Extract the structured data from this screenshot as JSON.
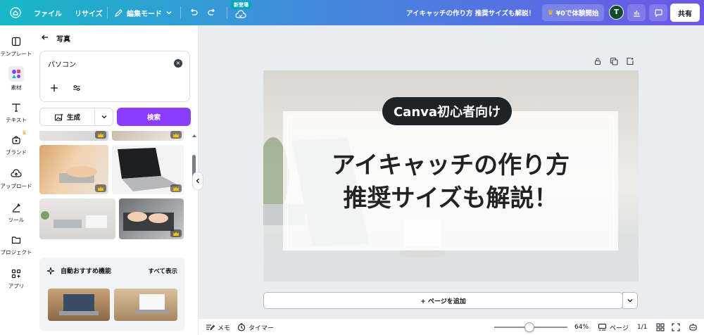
{
  "topbar": {
    "menu_file": "ファイル",
    "menu_resize": "リサイズ",
    "edit_mode": "編集モード",
    "new_badge": "新登場",
    "doc_title": "アイキャッチの作り方 推奨サイズも解説！",
    "trial_label": "¥0で体験開始",
    "avatar_initial": "T",
    "share_label": "共有"
  },
  "rail": {
    "items": [
      {
        "label": "テンプレート",
        "icon": "template-icon"
      },
      {
        "label": "素材",
        "icon": "elements-icon"
      },
      {
        "label": "テキスト",
        "icon": "text-icon"
      },
      {
        "label": "ブランド",
        "icon": "brand-icon"
      },
      {
        "label": "アップロード",
        "icon": "upload-icon"
      },
      {
        "label": "ツール",
        "icon": "tools-icon"
      },
      {
        "label": "プロジェクト",
        "icon": "folder-icon"
      },
      {
        "label": "アプリ",
        "icon": "apps-icon"
      }
    ]
  },
  "panel": {
    "title": "写真",
    "search_value": "パソコン",
    "generate_label": "生成",
    "search_button": "検索",
    "auto_title": "自動おすすめ機能",
    "see_all": "すべて表示"
  },
  "design": {
    "pill_text": "Canva初心者向け",
    "headline_line1": "アイキャッチの作り方",
    "headline_line2": "推奨サイズも解説！"
  },
  "canvas": {
    "add_page": "+ ページを追加"
  },
  "bottombar": {
    "notes": "メモ",
    "timer": "タイマー",
    "zoom": "64%",
    "pages_label": "ページ",
    "page_count": "1/1"
  },
  "colors": {
    "accent": "#8b3dff",
    "topbar_start": "#16b8c6",
    "topbar_end": "#6b56e8"
  }
}
